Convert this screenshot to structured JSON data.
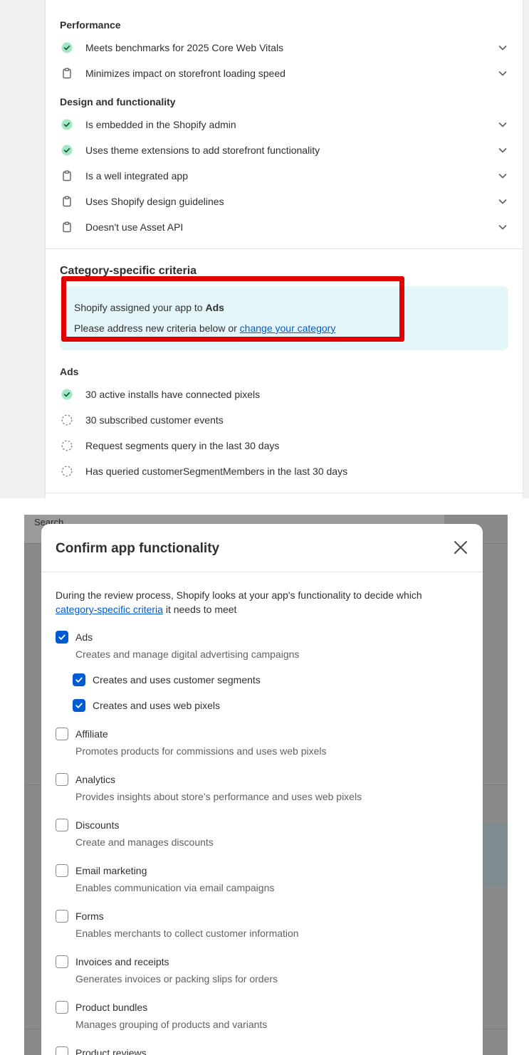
{
  "performance": {
    "title": "Performance",
    "items": [
      {
        "label": "Meets benchmarks for 2025 Core Web Vitals",
        "status": "passed"
      },
      {
        "label": "Minimizes impact on storefront loading speed",
        "status": "review"
      }
    ]
  },
  "design": {
    "title": "Design and functionality",
    "items": [
      {
        "label": "Is embedded in the Shopify admin",
        "status": "passed"
      },
      {
        "label": "Uses theme extensions to add storefront functionality",
        "status": "passed"
      },
      {
        "label": "Is a well integrated app",
        "status": "review"
      },
      {
        "label": "Uses Shopify design guidelines",
        "status": "review"
      },
      {
        "label": "Doesn't use Asset API",
        "status": "review"
      }
    ]
  },
  "category": {
    "title": "Category-specific criteria",
    "banner_prefix": "Shopify assigned your app to ",
    "banner_category": "Ads",
    "banner_line2_prefix": "Please address new criteria below or ",
    "banner_link": "change your category"
  },
  "ads": {
    "title": "Ads",
    "items": [
      {
        "label": "30 active installs have connected pixels",
        "status": "passed"
      },
      {
        "label": "30 subscribed customer events",
        "status": "pending"
      },
      {
        "label": "Request segments query in the last 30 days",
        "status": "pending"
      },
      {
        "label": "Has queried customerSegmentMembers in the last 30 days",
        "status": "pending"
      }
    ]
  },
  "background": {
    "search_placeholder": "Search"
  },
  "modal": {
    "title": "Confirm app functionality",
    "intro_text": "During the review process, Shopify looks at your app's functionality to decide which",
    "intro_link": "category-specific criteria",
    "intro_suffix": " it needs to meet",
    "options": [
      {
        "label": "Ads",
        "description": "Creates and manage digital advertising campaigns",
        "checked": true
      },
      {
        "label": "Creates and uses customer segments",
        "description": "",
        "checked": true,
        "sub": true
      },
      {
        "label": "Creates and uses web pixels",
        "description": "",
        "checked": true,
        "sub": true
      },
      {
        "label": "Affiliate",
        "description": "Promotes products for commissions and uses web pixels",
        "checked": false
      },
      {
        "label": "Analytics",
        "description": "Provides insights about store’s performance and uses web pixels",
        "checked": false
      },
      {
        "label": "Discounts",
        "description": "Create and manages discounts",
        "checked": false
      },
      {
        "label": "Email marketing",
        "description": "Enables communication via email campaigns",
        "checked": false
      },
      {
        "label": "Forms",
        "description": "Enables merchants to collect customer information",
        "checked": false
      },
      {
        "label": "Invoices and receipts",
        "description": "Generates invoices or packing slips for orders",
        "checked": false
      },
      {
        "label": "Product bundles",
        "description": "Manages grouping of products and variants",
        "checked": false
      },
      {
        "label": "Product reviews",
        "description": "",
        "checked": false
      }
    ]
  },
  "colors": {
    "accent": "#005bd3",
    "success": "#29845a",
    "highlight": "#e00000",
    "banner_bg": "#e5f6fb"
  }
}
